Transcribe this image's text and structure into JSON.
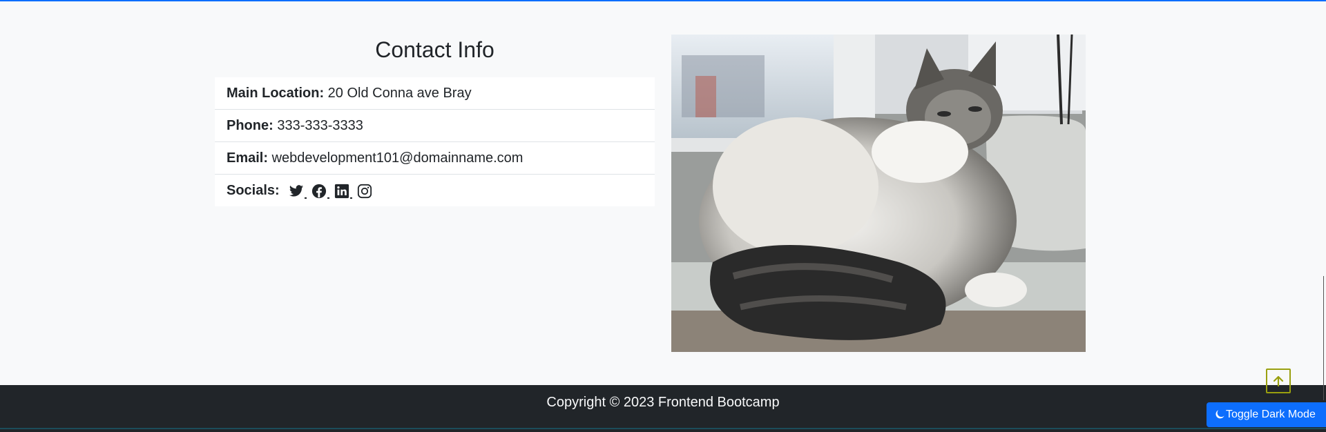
{
  "contact": {
    "title": "Contact Info",
    "location_label": "Main Location:",
    "location_value": "20 Old Conna ave Bray",
    "phone_label": "Phone:",
    "phone_value": "333-333-3333",
    "email_label": "Email:",
    "email_value": "webdevelopment101@domainname.com",
    "socials_label": "Socials:",
    "socials": [
      "twitter-icon",
      "facebook-icon",
      "linkedin-icon",
      "instagram-icon"
    ]
  },
  "photo": {
    "subject": "cat"
  },
  "footer": {
    "copyright": "Copyright © 2023 Frontend Bootcamp"
  },
  "controls": {
    "toggle_dark_label": "Toggle Dark Mode"
  },
  "colors": {
    "accent": "#0d6efd",
    "footer_bg": "#212529",
    "page_bg": "#f8f9fa",
    "scroll_top_border": "#9aa00f"
  }
}
